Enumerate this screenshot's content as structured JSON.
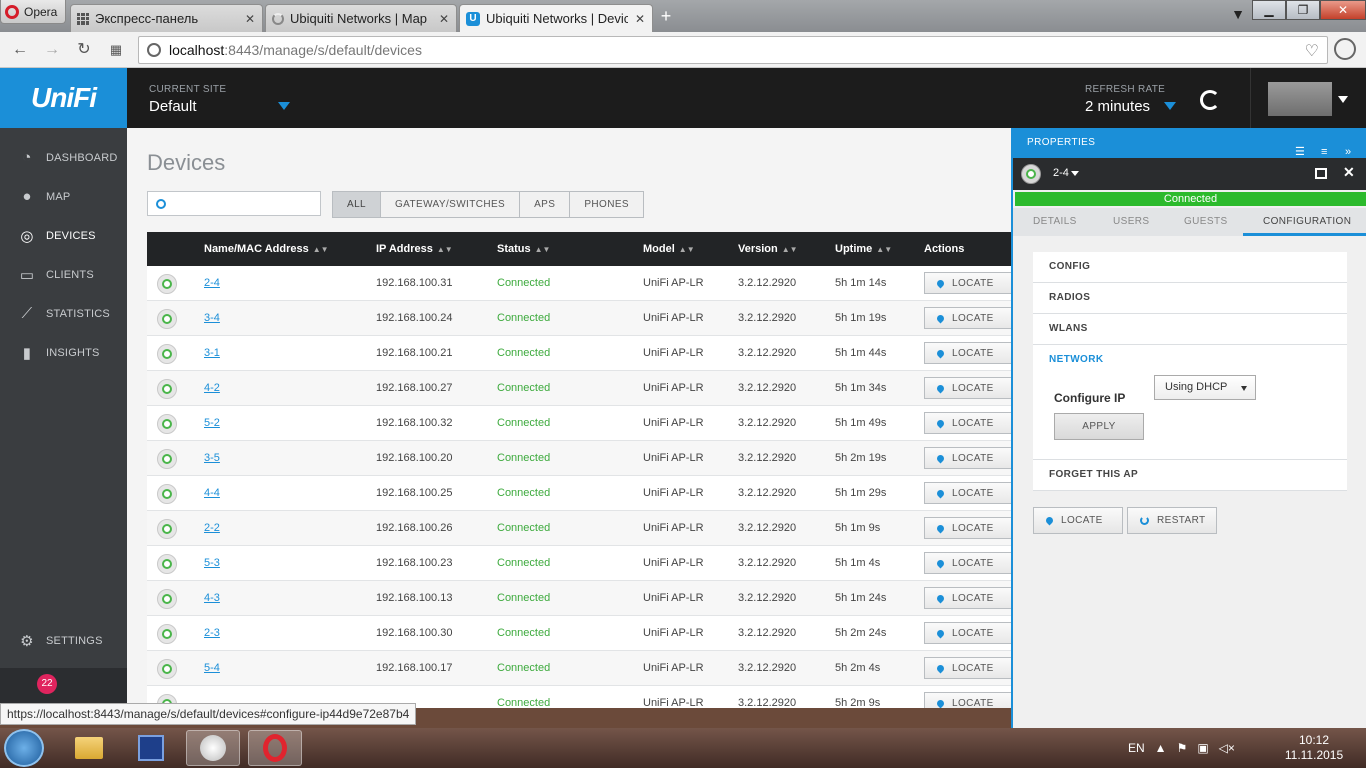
{
  "browser": {
    "menu_label": "Opera",
    "tabs": [
      {
        "title": "Экспресс-панель",
        "icon": "speed-dial-icon"
      },
      {
        "title": "Ubiquiti Networks | Map",
        "icon": "loading-icon"
      },
      {
        "title": "Ubiquiti Networks | Device",
        "icon": "unifi-icon"
      }
    ],
    "url_host": "localhost",
    "url_rest": ":8443/manage/s/default/devices"
  },
  "header": {
    "logo": "UniFi",
    "site_label": "CURRENT SITE",
    "site_value": "Default",
    "refresh_label": "REFRESH RATE",
    "refresh_value": "2 minutes"
  },
  "sidebar": {
    "items": [
      {
        "label": "DASHBOARD",
        "icon": "dashboard-icon"
      },
      {
        "label": "MAP",
        "icon": "map-pin-icon"
      },
      {
        "label": "DEVICES",
        "icon": "devices-icon"
      },
      {
        "label": "CLIENTS",
        "icon": "clients-icon"
      },
      {
        "label": "STATISTICS",
        "icon": "statistics-icon"
      },
      {
        "label": "INSIGHTS",
        "icon": "insights-icon"
      },
      {
        "label": "SETTINGS",
        "icon": "settings-icon"
      }
    ],
    "alert_count": "22"
  },
  "main": {
    "title": "Devices",
    "search_placeholder": "",
    "filters": [
      "ALL",
      "GATEWAY/SWITCHES",
      "APS",
      "PHONES"
    ],
    "columns": [
      "Name/MAC Address",
      "IP Address",
      "Status",
      "Model",
      "Version",
      "Uptime",
      "Actions"
    ],
    "locate_label": "LOCATE",
    "rows": [
      {
        "name": "2-4",
        "ip": "192.168.100.31",
        "status": "Connected",
        "model": "UniFi AP-LR",
        "version": "3.2.12.2920",
        "uptime": "5h 1m 14s"
      },
      {
        "name": "3-4",
        "ip": "192.168.100.24",
        "status": "Connected",
        "model": "UniFi AP-LR",
        "version": "3.2.12.2920",
        "uptime": "5h 1m 19s"
      },
      {
        "name": "3-1",
        "ip": "192.168.100.21",
        "status": "Connected",
        "model": "UniFi AP-LR",
        "version": "3.2.12.2920",
        "uptime": "5h 1m 44s"
      },
      {
        "name": "4-2",
        "ip": "192.168.100.27",
        "status": "Connected",
        "model": "UniFi AP-LR",
        "version": "3.2.12.2920",
        "uptime": "5h 1m 34s"
      },
      {
        "name": "5-2",
        "ip": "192.168.100.32",
        "status": "Connected",
        "model": "UniFi AP-LR",
        "version": "3.2.12.2920",
        "uptime": "5h 1m 49s"
      },
      {
        "name": "3-5",
        "ip": "192.168.100.20",
        "status": "Connected",
        "model": "UniFi AP-LR",
        "version": "3.2.12.2920",
        "uptime": "5h 2m 19s"
      },
      {
        "name": "4-4",
        "ip": "192.168.100.25",
        "status": "Connected",
        "model": "UniFi AP-LR",
        "version": "3.2.12.2920",
        "uptime": "5h 1m 29s"
      },
      {
        "name": "2-2",
        "ip": "192.168.100.26",
        "status": "Connected",
        "model": "UniFi AP-LR",
        "version": "3.2.12.2920",
        "uptime": "5h 1m 9s"
      },
      {
        "name": "5-3",
        "ip": "192.168.100.23",
        "status": "Connected",
        "model": "UniFi AP-LR",
        "version": "3.2.12.2920",
        "uptime": "5h 1m 4s"
      },
      {
        "name": "4-3",
        "ip": "192.168.100.13",
        "status": "Connected",
        "model": "UniFi AP-LR",
        "version": "3.2.12.2920",
        "uptime": "5h 1m 24s"
      },
      {
        "name": "2-3",
        "ip": "192.168.100.30",
        "status": "Connected",
        "model": "UniFi AP-LR",
        "version": "3.2.12.2920",
        "uptime": "5h 2m 24s"
      },
      {
        "name": "5-4",
        "ip": "192.168.100.17",
        "status": "Connected",
        "model": "UniFi AP-LR",
        "version": "3.2.12.2920",
        "uptime": "5h 2m 4s"
      },
      {
        "name": "",
        "ip": "",
        "status": "Connected",
        "model": "UniFi AP-LR",
        "version": "3.2.12.2920",
        "uptime": "5h 2m 9s"
      }
    ]
  },
  "properties": {
    "title": "PROPERTIES",
    "device_name": "2-4",
    "status": "Connected",
    "tabs": [
      "DETAILS",
      "USERS",
      "GUESTS",
      "CONFIGURATION"
    ],
    "sections": [
      "CONFIG",
      "RADIOS",
      "WLANS",
      "NETWORK",
      "FORGET THIS AP"
    ],
    "configure_ip_label": "Configure IP",
    "configure_ip_value": "Using DHCP",
    "apply_label": "APPLY",
    "locate_label": "LOCATE",
    "restart_label": "RESTART"
  },
  "status_url": "https://localhost:8443/manage/s/default/devices#configure-ip44d9e72e87b4",
  "taskbar": {
    "lang": "EN",
    "time": "10:12",
    "date": "11.11.2015"
  },
  "colors": {
    "brand": "#1b8fd8",
    "connected": "#2cba2c",
    "alert": "#e0245e"
  }
}
